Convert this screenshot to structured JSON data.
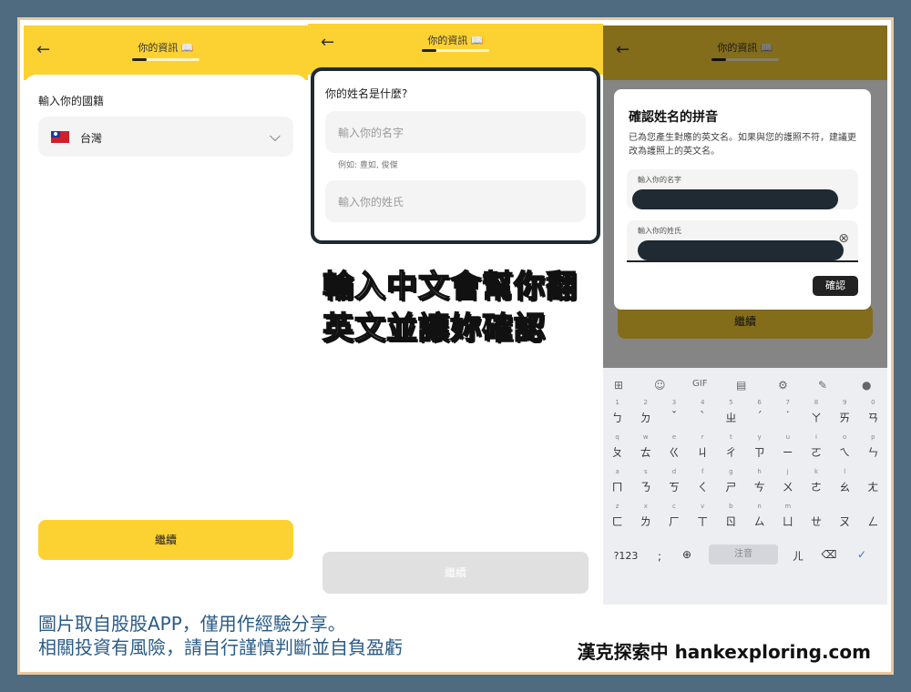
{
  "screens": [
    {
      "header_title": "你的資訊 📖",
      "field_label": "輸入你的國籍",
      "country": "台灣",
      "continue_label": "繼續"
    },
    {
      "header_title": "你的資訊 📖",
      "question": "你的姓名是什麼?",
      "first_name_placeholder": "輸入你的名字",
      "example_hint": "例如: 豊如, 俊傑",
      "last_name_placeholder": "輸入你的姓氏",
      "continue_label": "繼續"
    },
    {
      "header_title": "你的資訊 📖",
      "dialog_title": "確認姓名的拼音",
      "dialog_desc": "已為您產生對應的英文名。如果與您的護照不符，建議更改為護照上的英文名。",
      "first_name_label": "輸入你的名字",
      "last_name_label": "輸入你的姓氏",
      "confirm_label": "確認",
      "continue_label": "繼續"
    }
  ],
  "keyboard": {
    "space_label": "注音",
    "num_label": "?123",
    "rows": [
      [
        [
          "1",
          "ㄅ"
        ],
        [
          "2",
          "ㄉ"
        ],
        [
          "3",
          "ˇ"
        ],
        [
          "4",
          "ˋ"
        ],
        [
          "5",
          "ㄓ"
        ],
        [
          "6",
          "ˊ"
        ],
        [
          "7",
          "˙"
        ],
        [
          "8",
          "ㄚ"
        ],
        [
          "9",
          "ㄞ"
        ],
        [
          "0",
          "ㄢ"
        ]
      ],
      [
        [
          "q",
          "ㄆ"
        ],
        [
          "w",
          "ㄊ"
        ],
        [
          "e",
          "ㄍ"
        ],
        [
          "r",
          "ㄐ"
        ],
        [
          "t",
          "ㄔ"
        ],
        [
          "y",
          "ㄗ"
        ],
        [
          "u",
          "ㄧ"
        ],
        [
          "i",
          "ㄛ"
        ],
        [
          "o",
          "ㄟ"
        ],
        [
          "p",
          "ㄣ"
        ]
      ],
      [
        [
          "a",
          "ㄇ"
        ],
        [
          "s",
          "ㄋ"
        ],
        [
          "d",
          "ㄎ"
        ],
        [
          "f",
          "ㄑ"
        ],
        [
          "g",
          "ㄕ"
        ],
        [
          "h",
          "ㄘ"
        ],
        [
          "j",
          "ㄨ"
        ],
        [
          "k",
          "ㄜ"
        ],
        [
          "l",
          "ㄠ"
        ],
        [
          "",
          "ㄤ"
        ]
      ],
      [
        [
          "z",
          "ㄈ"
        ],
        [
          "x",
          "ㄌ"
        ],
        [
          "c",
          "ㄏ"
        ],
        [
          "v",
          "ㄒ"
        ],
        [
          "b",
          "ㄖ"
        ],
        [
          "n",
          "ㄙ"
        ],
        [
          "m",
          "ㄩ"
        ],
        [
          "",
          "ㄝ"
        ],
        [
          "",
          "ㄡ"
        ],
        [
          "",
          "ㄥ"
        ]
      ]
    ]
  },
  "overlay_text": [
    "輸入中文會幫你翻",
    "英文並讓妳確認"
  ],
  "footer": {
    "disclaimer_line1": "圖片取自股股APP，僅用作經驗分享。",
    "disclaimer_line2": "相關投資有風險，請自行謹慎判斷並自負盈虧",
    "brand": "漢克探索中 hankexploring.com"
  }
}
